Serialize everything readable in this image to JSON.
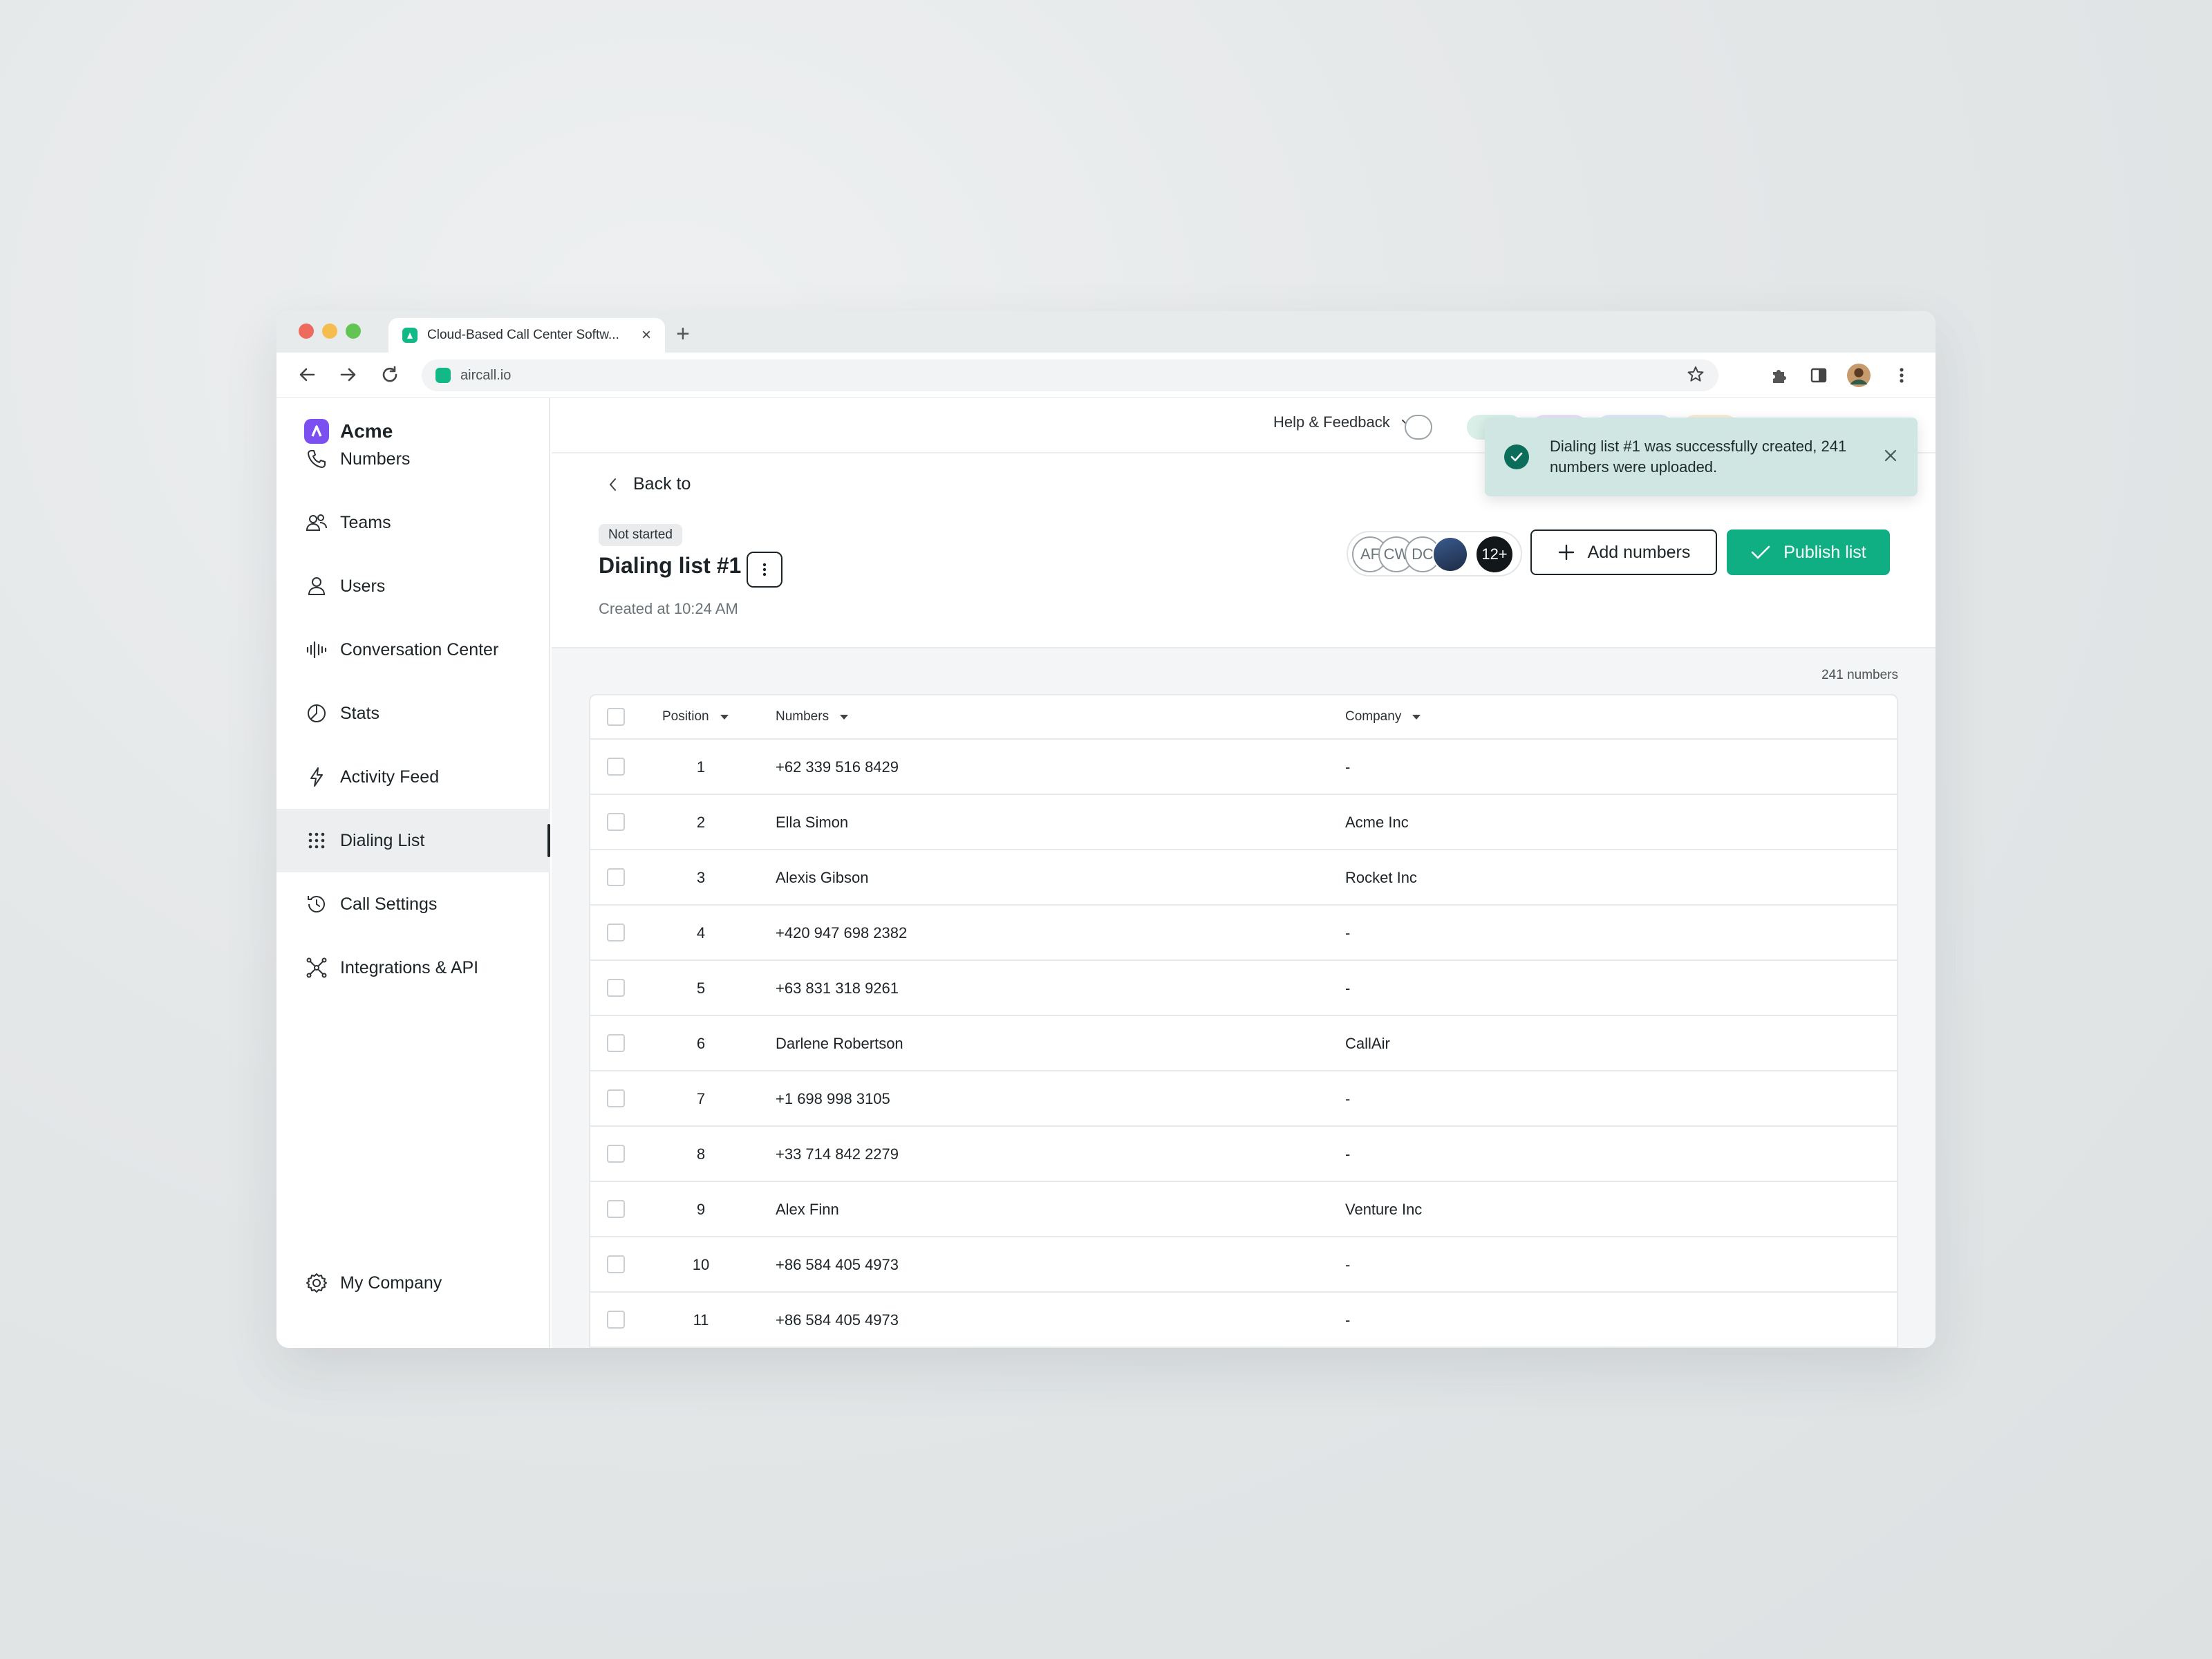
{
  "browser": {
    "tab_title": "Cloud-Based Call Center Softw...",
    "url": "aircall.io",
    "traffic_lights": [
      "#ee6a5f",
      "#f5bd4f",
      "#61c454"
    ]
  },
  "sidebar": {
    "brand": "Acme",
    "items": [
      {
        "label": "Numbers",
        "icon": "phone-icon"
      },
      {
        "label": "Teams",
        "icon": "team-icon"
      },
      {
        "label": "Users",
        "icon": "user-icon"
      },
      {
        "label": "Conversation Center",
        "icon": "waveform-icon"
      },
      {
        "label": "Stats",
        "icon": "pie-chart-icon"
      },
      {
        "label": "Activity Feed",
        "icon": "lightning-icon"
      },
      {
        "label": "Dialing List",
        "icon": "grid-dots-icon",
        "active": true
      },
      {
        "label": "Call Settings",
        "icon": "clock-icon"
      },
      {
        "label": "Integrations & API",
        "icon": "network-icon"
      }
    ],
    "footer": {
      "label": "My Company",
      "icon": "gear-icon"
    }
  },
  "topbar": {
    "help_label": "Help & Feedback"
  },
  "toast": {
    "message": "Dialing list #1 was successfully created, 241 numbers were uploaded."
  },
  "header": {
    "back_label": "Back to",
    "status": "Not started",
    "title": "Dialing list #1",
    "created": "Created at 10:24 AM",
    "avatars": [
      "AF",
      "CW",
      "DC"
    ],
    "avatars_more": "12+",
    "add_label": "Add numbers",
    "publish_label": "Publish list"
  },
  "table": {
    "count": "241 numbers",
    "columns": [
      "Position",
      "Numbers",
      "Company"
    ],
    "rows": [
      {
        "position": "1",
        "number": "+62 339 516 8429",
        "company": "-"
      },
      {
        "position": "2",
        "number": "Ella Simon",
        "company": "Acme Inc"
      },
      {
        "position": "3",
        "number": "Alexis Gibson",
        "company": "Rocket Inc"
      },
      {
        "position": "4",
        "number": "+420 947 698 2382",
        "company": "-"
      },
      {
        "position": "5",
        "number": "+63 831 318 9261",
        "company": "-"
      },
      {
        "position": "6",
        "number": "Darlene Robertson",
        "company": "CallAir"
      },
      {
        "position": "7",
        "number": "+1 698 998 3105",
        "company": "-"
      },
      {
        "position": "8",
        "number": "+33 714 842 2279",
        "company": "-"
      },
      {
        "position": "9",
        "number": "Alex Finn",
        "company": "Venture Inc"
      },
      {
        "position": "10",
        "number": "+86 584 405 4973",
        "company": "-"
      },
      {
        "position": "11",
        "number": "+86 584 405 4973",
        "company": "-"
      }
    ]
  },
  "colors": {
    "accent": "#0fae83",
    "brand": "#7b4ff0",
    "toast_bg": "#cfe6e2"
  }
}
